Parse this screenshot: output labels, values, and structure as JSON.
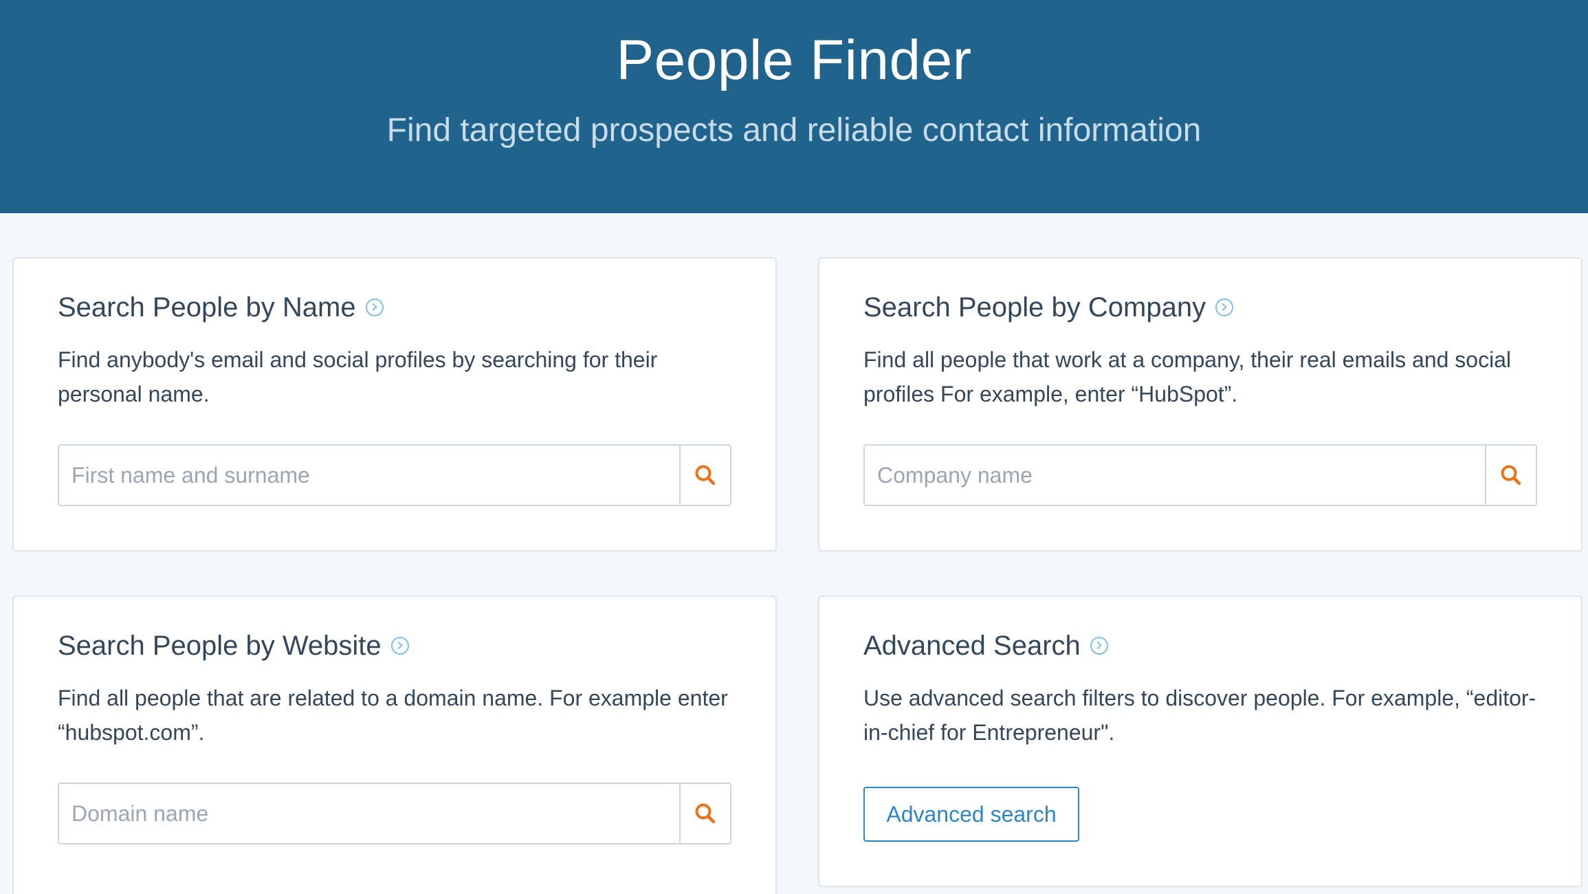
{
  "header": {
    "title": "People Finder",
    "subtitle": "Find targeted prospects and reliable contact information"
  },
  "cards": [
    {
      "title": "Search People by Name",
      "description": "Find anybody's email and social profiles by searching for their personal name.",
      "input_placeholder": "First name and surname",
      "input_value": ""
    },
    {
      "title": "Search People by Company",
      "description": "Find all people that work at a company, their real emails and social profiles For example, enter “HubSpot”.",
      "input_placeholder": "Company name",
      "input_value": ""
    },
    {
      "title": "Search People by Website",
      "description": "Find all people that are related to a domain name. For example enter “hubspot.com”.",
      "input_placeholder": "Domain name",
      "input_value": ""
    },
    {
      "title": "Advanced Search",
      "description": "Use advanced search filters to discover people. For example, “editor-in-chief for Entrepreneur\".",
      "button_label": "Advanced search"
    }
  ],
  "icons": {
    "info": "chevron-circle-right-icon",
    "search": "magnifier-icon"
  },
  "colors": {
    "header_bg": "#20638c",
    "accent_blue": "#2d86c4",
    "search_icon": "#e8741a",
    "text": "#33475b"
  }
}
